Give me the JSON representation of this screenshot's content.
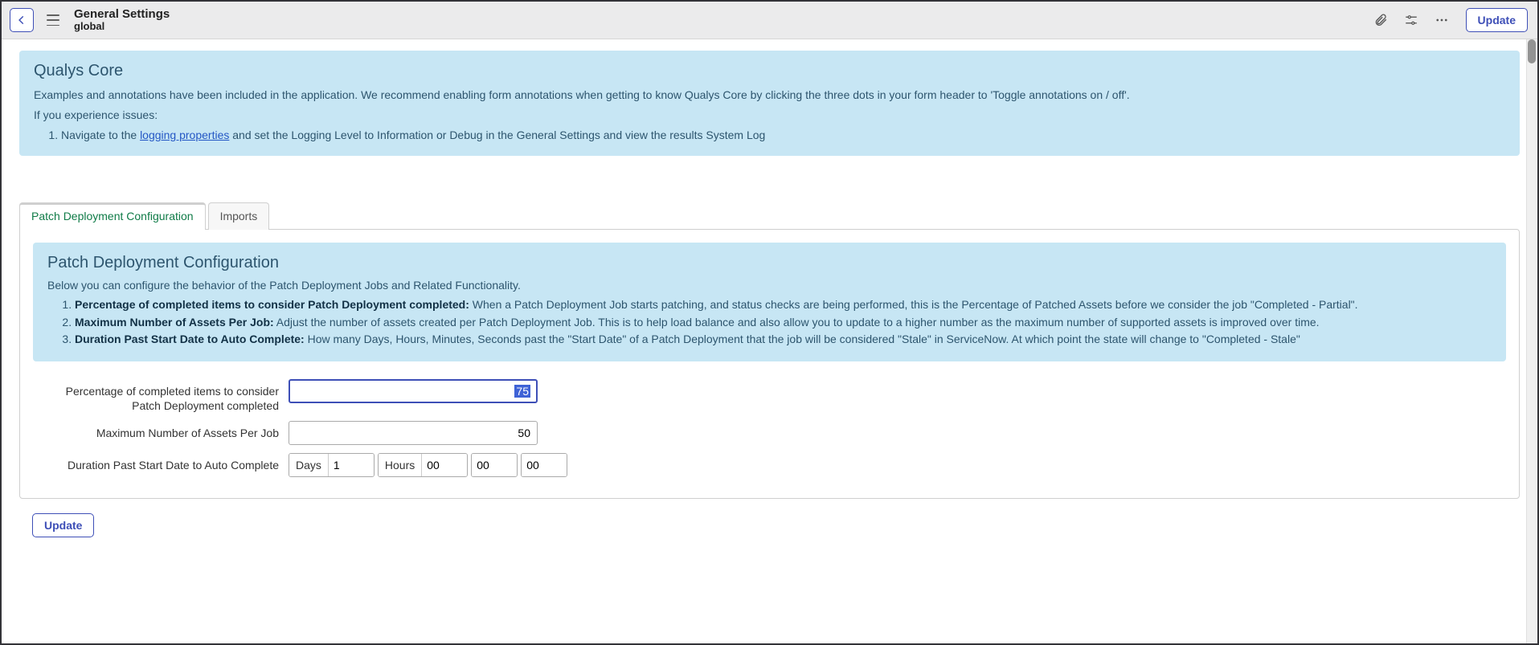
{
  "header": {
    "title": "General Settings",
    "subtitle": "global",
    "update_label": "Update"
  },
  "info_panel": {
    "title": "Qualys Core",
    "intro": "Examples and annotations have been included in the application. We recommend enabling form annotations when getting to know Qualys Core by clicking the three dots in your form header to 'Toggle annotations on / off'.",
    "issues_prefix": "If you experience issues:",
    "step1_prefix": "Navigate to the ",
    "step1_link": "logging properties",
    "step1_suffix": " and set the Logging Level to Information or Debug in the General Settings and view the results System Log"
  },
  "tabs": {
    "tab0": {
      "label": "Patch Deployment Configuration"
    },
    "tab1": {
      "label": "Imports"
    }
  },
  "tab_panel": {
    "title": "Patch Deployment Configuration",
    "desc": "Below you can configure the behavior of the Patch Deployment Jobs and Related Functionality.",
    "item1_bold": "Percentage of completed items to consider Patch Deployment completed:",
    "item1_text": " When a Patch Deployment Job starts patching, and status checks are being performed, this is the Percentage of Patched Assets before we consider the job \"Completed - Partial\".",
    "item2_bold": "Maximum Number of Assets Per Job:",
    "item2_text": " Adjust the number of assets created per Patch Deployment Job. This is to help load balance and also allow you to update to a higher number as the maximum number of supported assets is improved over time.",
    "item3_bold": "Duration Past Start Date to Auto Complete:",
    "item3_text": " How many Days, Hours, Minutes, Seconds past the \"Start Date\" of a Patch Deployment that the job will be considered \"Stale\" in ServiceNow. At which point the state will change to \"Completed - Stale\""
  },
  "form": {
    "pct_label": "Percentage of completed items to consider Patch Deployment completed",
    "pct_value": "75",
    "max_label": "Maximum Number of Assets Per Job",
    "max_value": "50",
    "dur_label": "Duration Past Start Date to Auto Complete",
    "dur_days_label": "Days",
    "dur_days_value": "1",
    "dur_hours_label": "Hours",
    "dur_hours_value": "00",
    "dur_min_value": "00",
    "dur_sec_value": "00"
  },
  "footer": {
    "update_label": "Update"
  }
}
